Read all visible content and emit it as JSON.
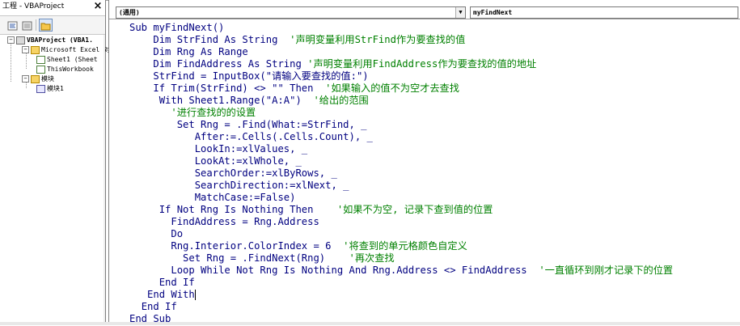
{
  "project_pane": {
    "title": "工程 - VBAProject",
    "close_glyph": "×",
    "tree": {
      "root": "VBAProject (VBA1.",
      "excel_objects_folder": "Microsoft Excel 对",
      "sheet1": "Sheet1 (Sheet",
      "thisworkbook": "ThisWorkbook",
      "modules_folder": "模块",
      "module1": "模块1"
    }
  },
  "code_window": {
    "object_combo": "(通用)",
    "procedure_combo": "myFindNext",
    "lines": [
      {
        "indent": "",
        "code": "Sub myFindNext()",
        "comment": ""
      },
      {
        "indent": "    ",
        "code": "Dim StrFind As String  ",
        "comment": "'声明变量利用StrFind作为要查找的值"
      },
      {
        "indent": "    ",
        "code": "Dim Rng As Range",
        "comment": ""
      },
      {
        "indent": "    ",
        "code": "Dim FindAddress As String ",
        "comment": "'声明变量利用FindAddress作为要查找的值的地址"
      },
      {
        "indent": "    ",
        "code": "StrFind = InputBox(\"请输入要查找的值:\")",
        "comment": ""
      },
      {
        "indent": "    ",
        "code": "If Trim(StrFind) <> \"\" Then  ",
        "comment": "'如果输入的值不为空才去查找"
      },
      {
        "indent": "     ",
        "code": "With Sheet1.Range(\"A:A\")  ",
        "comment": "'给出的范围"
      },
      {
        "indent": "       ",
        "code": "",
        "comment": "'进行查找的的设置"
      },
      {
        "indent": "        ",
        "code": "Set Rng = .Find(What:=StrFind, _",
        "comment": ""
      },
      {
        "indent": "           ",
        "code": "After:=.Cells(.Cells.Count), _",
        "comment": ""
      },
      {
        "indent": "           ",
        "code": "LookIn:=xlValues, _",
        "comment": ""
      },
      {
        "indent": "           ",
        "code": "LookAt:=xlWhole, _",
        "comment": ""
      },
      {
        "indent": "           ",
        "code": "SearchOrder:=xlByRows, _",
        "comment": ""
      },
      {
        "indent": "           ",
        "code": "SearchDirection:=xlNext, _",
        "comment": ""
      },
      {
        "indent": "           ",
        "code": "MatchCase:=False)",
        "comment": ""
      },
      {
        "indent": "     ",
        "code": "If Not Rng Is Nothing Then    ",
        "comment": "'如果不为空, 记录下查到值的位置"
      },
      {
        "indent": "       ",
        "code": "FindAddress = Rng.Address",
        "comment": ""
      },
      {
        "indent": "       ",
        "code": "Do",
        "comment": ""
      },
      {
        "indent": "       ",
        "code": "Rng.Interior.ColorIndex = 6  ",
        "comment": "'将查到的单元格颜色自定义"
      },
      {
        "indent": "         ",
        "code": "Set Rng = .FindNext(Rng)    ",
        "comment": "'再次查找"
      },
      {
        "indent": "       ",
        "code": "Loop While Not Rng Is Nothing And Rng.Address <> FindAddress  ",
        "comment": "'一直循环到刚才记录下的位置"
      },
      {
        "indent": "     ",
        "code": "End If",
        "comment": ""
      },
      {
        "indent": "   ",
        "code": "End With",
        "comment": ""
      },
      {
        "indent": "  ",
        "code": "End If",
        "comment": ""
      },
      {
        "indent": "",
        "code": "End Sub",
        "comment": ""
      }
    ]
  },
  "icons": {
    "close": "close-icon",
    "view_code": "view-code-icon",
    "view_object": "view-object-icon",
    "toggle_folders": "folder-icon"
  },
  "colors": {
    "code_text": "#000080",
    "comment_text": "#008000"
  }
}
